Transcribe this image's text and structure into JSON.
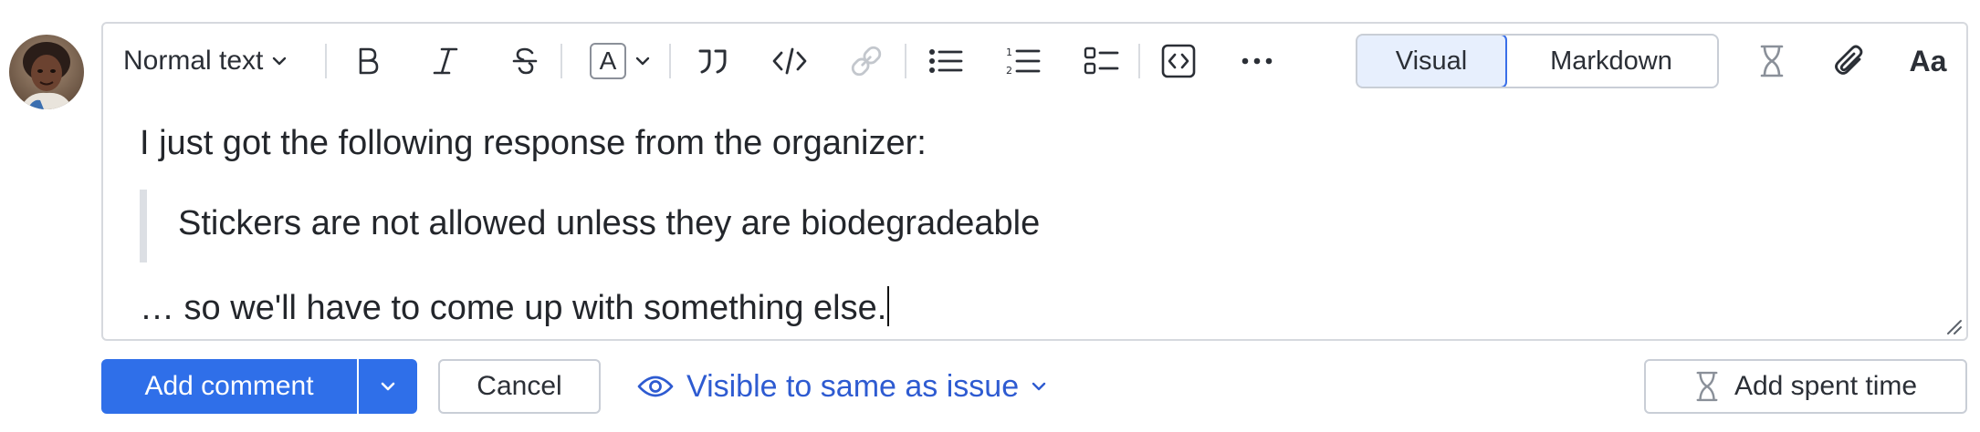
{
  "toolbar": {
    "text_style": "Normal text",
    "text_color_label": "A",
    "view_toggle": {
      "visual": "Visual",
      "markdown": "Markdown"
    },
    "font_button_label": "Aa"
  },
  "content": {
    "paragraph1": "I just got the following response from the organizer:",
    "quote": "Stickers are not allowed unless they are biodegradeable",
    "paragraph2": "… so we'll have to come up with something else."
  },
  "footer": {
    "add_comment": "Add comment",
    "cancel": "Cancel",
    "visibility": "Visible to same as issue",
    "add_spent_time": "Add spent time"
  },
  "colors": {
    "primary": "#2f6fe9",
    "link": "#2e5bd1",
    "border": "#d6d9de"
  }
}
